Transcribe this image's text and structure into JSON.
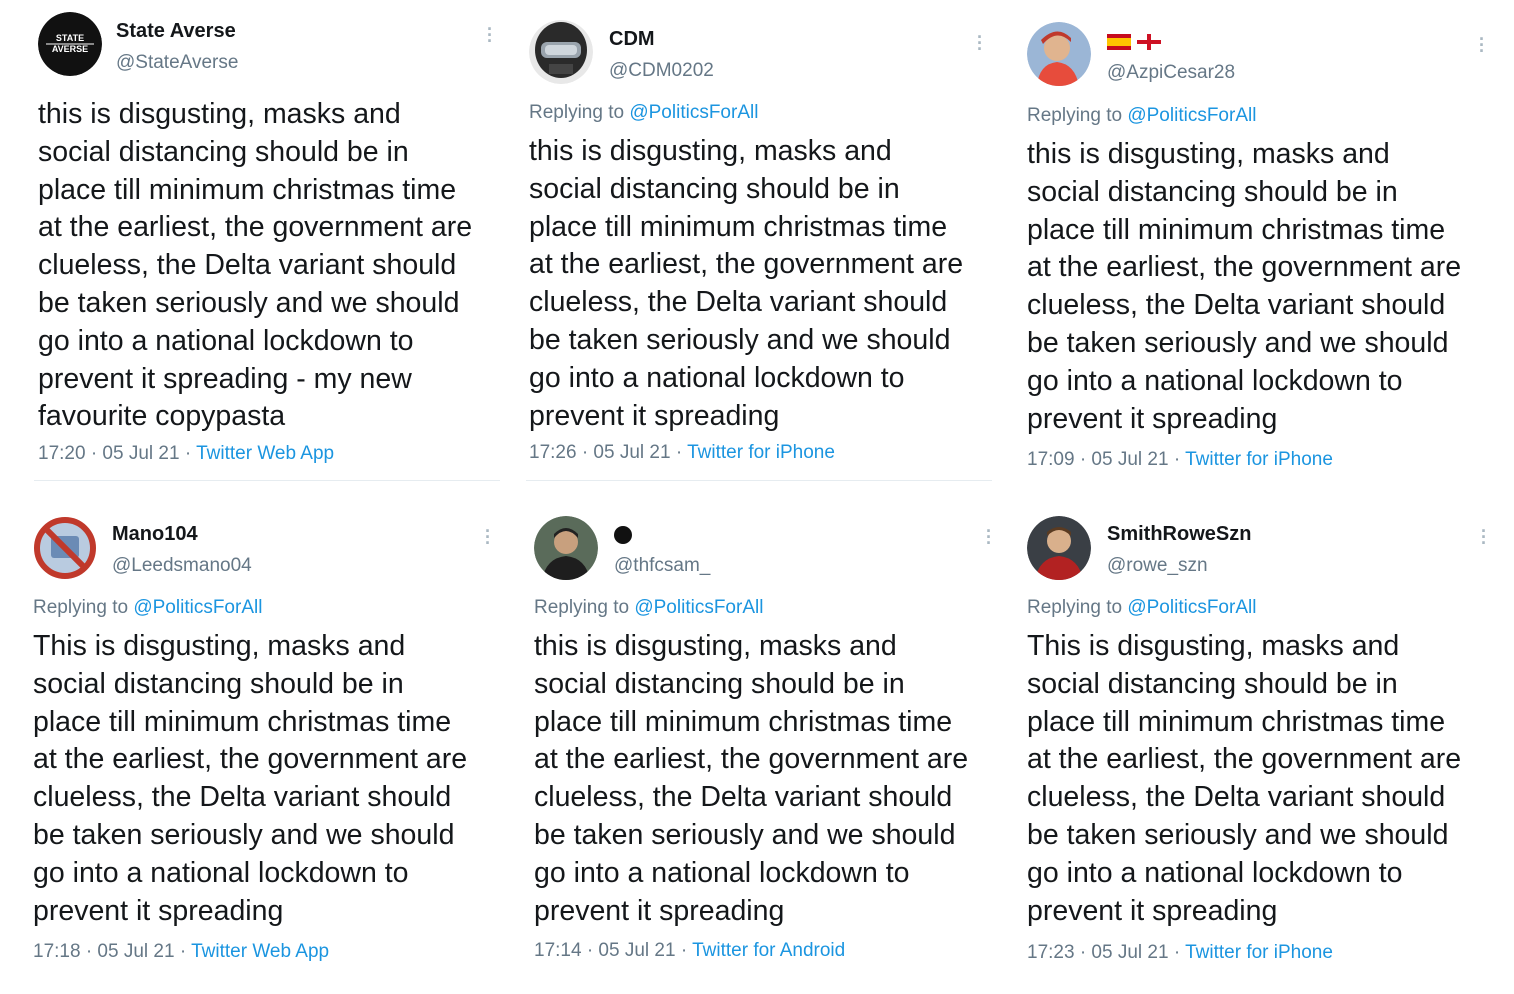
{
  "tweets": [
    {
      "name": "State Averse",
      "handle": "@StateAverse",
      "avatar_text": "STATE AVERSE",
      "reply_prefix": "",
      "reply_mention": "",
      "text": "this is disgusting, masks and\nsocial distancing should be in\nplace till minimum christmas time\nat the earliest, the government are\nclueless, the Delta  variant should\nbe taken seriously and we should\ngo into a national lockdown to\nprevent it spreading - my new\nfavourite copypasta",
      "time": "17:20 · 05 Jul 21 · ",
      "source": "Twitter Web App"
    },
    {
      "name": "CDM",
      "handle": "@CDM0202",
      "reply_prefix": "Replying to ",
      "reply_mention": "@PoliticsForAll",
      "text": "this is disgusting, masks and\nsocial distancing should be in\nplace till minimum christmas time\nat the earliest, the government are\nclueless, the Delta  variant should\nbe taken seriously and we should\ngo into a national lockdown to\nprevent it spreading",
      "time": "17:26 · 05 Jul 21 · ",
      "source": "Twitter for iPhone"
    },
    {
      "name": "",
      "handle": "@AzpiCesar28",
      "reply_prefix": "Replying to ",
      "reply_mention": "@PoliticsForAll",
      "text": "this is disgusting, masks and\nsocial distancing should be in\nplace till minimum christmas time\nat the earliest, the government are\nclueless, the Delta  variant should\nbe taken seriously and we should\ngo into a national lockdown to\nprevent it spreading",
      "time": "17:09 · 05 Jul 21 · ",
      "source": "Twitter for iPhone"
    },
    {
      "name": "Mano104",
      "handle": "@Leedsmano04",
      "reply_prefix": "Replying to ",
      "reply_mention": "@PoliticsForAll",
      "text": "This is disgusting, masks and\nsocial distancing should be in\nplace till minimum christmas time\nat the earliest, the government are\nclueless, the Delta  variant should\nbe taken seriously and we should\ngo into a national lockdown to\nprevent it spreading",
      "time": "17:18 · 05 Jul 21 · ",
      "source": "Twitter Web App"
    },
    {
      "name": "",
      "handle": "@thfcsam_",
      "reply_prefix": "Replying to ",
      "reply_mention": "@PoliticsForAll",
      "text": "this is disgusting, masks and\nsocial distancing should be in\nplace till minimum christmas time\nat the earliest, the government are\nclueless, the Delta  variant should\nbe taken seriously and we should\ngo into a national lockdown to\nprevent it spreading",
      "time": "17:14 · 05 Jul 21 · ",
      "source": "Twitter for Android"
    },
    {
      "name": "SmithRoweSzn",
      "handle": "@rowe_szn",
      "reply_prefix": "Replying to ",
      "reply_mention": "@PoliticsForAll",
      "text": "This is disgusting, masks and\nsocial distancing should be in\nplace till minimum christmas time\nat the earliest, the government are\nclueless, the Delta  variant should\nbe taken seriously and we should\ngo into a national lockdown to\nprevent it spreading",
      "time": "17:23 · 05 Jul 21 · ",
      "source": "Twitter for iPhone"
    }
  ],
  "colors": {
    "text": "#14171a",
    "secondary": "#657786",
    "link": "#1b95e0",
    "divider": "#e6ecf0"
  },
  "icons": [
    "more-options-icon",
    "spain-flag-icon",
    "england-flag-icon",
    "black-circle-emoji-icon"
  ]
}
